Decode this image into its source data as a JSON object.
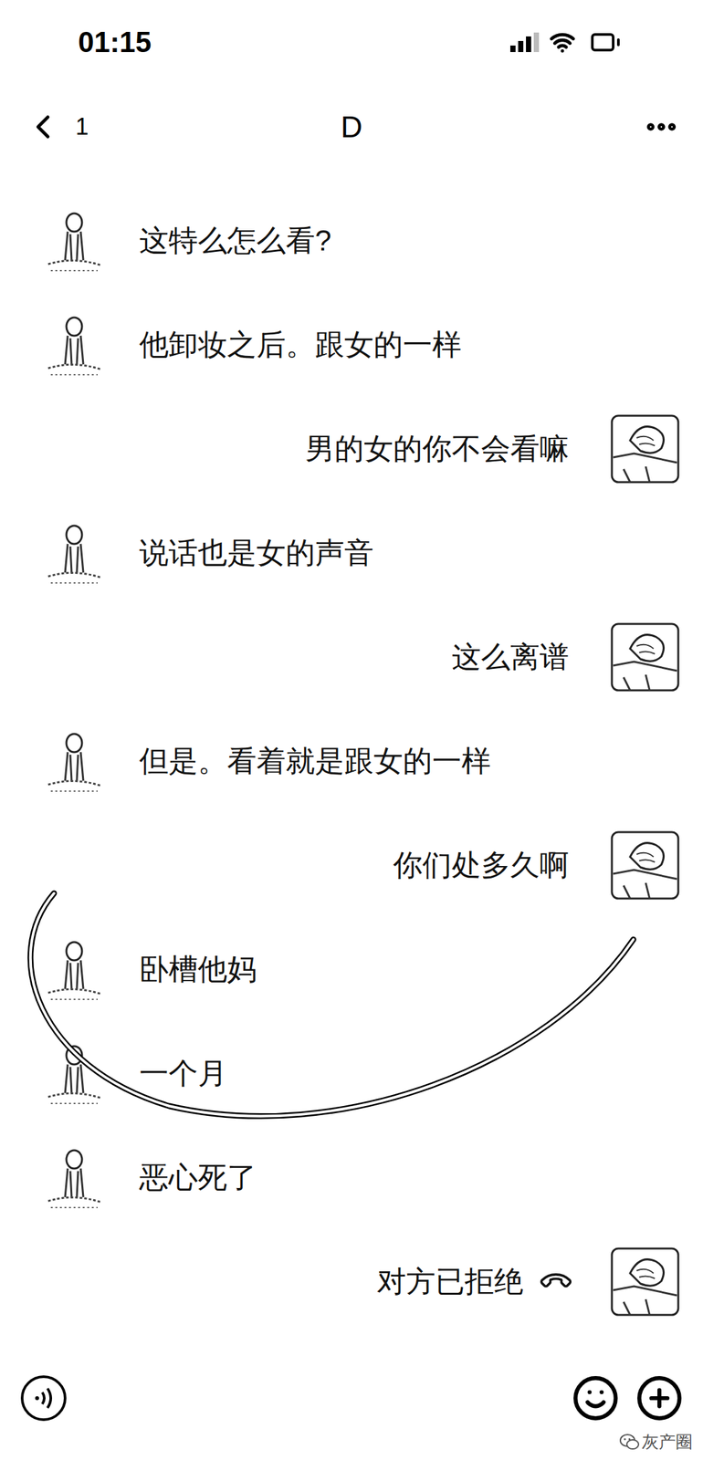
{
  "status_bar": {
    "time": "01:15"
  },
  "header": {
    "back_count": "1",
    "title": "D"
  },
  "messages": [
    {
      "from": "other",
      "kind": "text",
      "text": "这特么怎么看?"
    },
    {
      "from": "other",
      "kind": "text",
      "text": "他卸妆之后。跟女的一样"
    },
    {
      "from": "me",
      "kind": "text",
      "text": "男的女的你不会看嘛"
    },
    {
      "from": "other",
      "kind": "text",
      "text": "说话也是女的声音"
    },
    {
      "from": "me",
      "kind": "text",
      "text": "这么离谱"
    },
    {
      "from": "other",
      "kind": "text",
      "text": "但是。看着就是跟女的一样"
    },
    {
      "from": "me",
      "kind": "text",
      "text": "你们处多久啊"
    },
    {
      "from": "other",
      "kind": "text",
      "text": "卧槽他妈"
    },
    {
      "from": "other",
      "kind": "text",
      "text": "一个月"
    },
    {
      "from": "other",
      "kind": "text",
      "text": "恶心死了"
    },
    {
      "from": "me",
      "kind": "call",
      "text": "对方已拒绝"
    }
  ],
  "watermark": {
    "text": "灰产圈"
  }
}
